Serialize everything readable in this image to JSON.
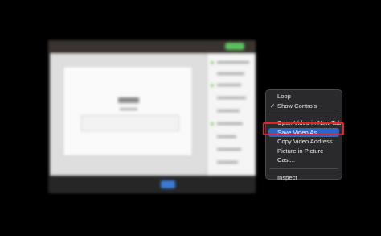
{
  "context_menu": {
    "loop": "Loop",
    "show_controls": "Show Controls",
    "show_controls_checked": true,
    "open_video_new_tab": "Open Video in New Tab",
    "save_video_as": "Save Video As...",
    "copy_video_address": "Copy Video Address",
    "picture_in_picture": "Picture in Picture",
    "cast": "Cast...",
    "inspect": "Inspect",
    "highlighted_item": "Save Video As..."
  },
  "colors": {
    "menu_background": "#2a2a2c",
    "menu_highlight": "#2e63c9",
    "annotation_box": "#e0262a"
  },
  "icons": {
    "checkmark": "checkmark-icon"
  }
}
